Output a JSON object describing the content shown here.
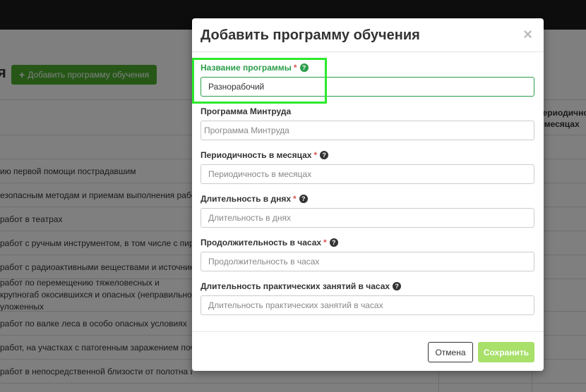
{
  "background": {
    "page_title": "я",
    "add_button_label": "Добавить программу обучения",
    "column_header_period": "Периодичность в месяцах",
    "rows": [
      "ию первой помощи пострадавшим",
      "езопасным методам и приемам выполнения работ",
      "работ в театрах",
      "работ с ручным инструментом, в том числе с пиро",
      "работ с радиоактивными веществами и источника",
      "работ по перемещению тяжеловесных и крупногаб окосившихся и опасных (неправильно уложенных",
      "работ по валке леса в особо опасных условиях",
      "работ, на участках с патогенным заражением почв",
      "работ в непосредственной близости от полотна ил"
    ]
  },
  "modal": {
    "title": "Добавить программу обучения",
    "close_label": "×",
    "fields": [
      {
        "label": "Название программы",
        "required": "*",
        "value": "Разнорабочий",
        "placeholder": ""
      },
      {
        "label": "Программа Минтруда",
        "required": "",
        "value": "",
        "placeholder": "Программа Минтруда"
      },
      {
        "label": "Периодичность в месяцах",
        "required": "*",
        "value": "",
        "placeholder": "Периодичность в месяцах"
      },
      {
        "label": "Длительность в днях",
        "required": "*",
        "value": "",
        "placeholder": "Длительность в днях"
      },
      {
        "label": "Продолжительность в часах",
        "required": "*",
        "value": "",
        "placeholder": "Продолжительность в часах"
      },
      {
        "label": "Длительность практических занятий в часах",
        "required": "",
        "value": "",
        "placeholder": "Длительность практических занятий в часах"
      }
    ],
    "help_glyph": "?",
    "cancel_label": "Отмена",
    "save_label": "Сохранить"
  },
  "colors": {
    "accent_green": "#2a9d4a",
    "highlight": "#2bea2b",
    "save_button": "#a8e06a",
    "add_button": "#4cae2e"
  }
}
